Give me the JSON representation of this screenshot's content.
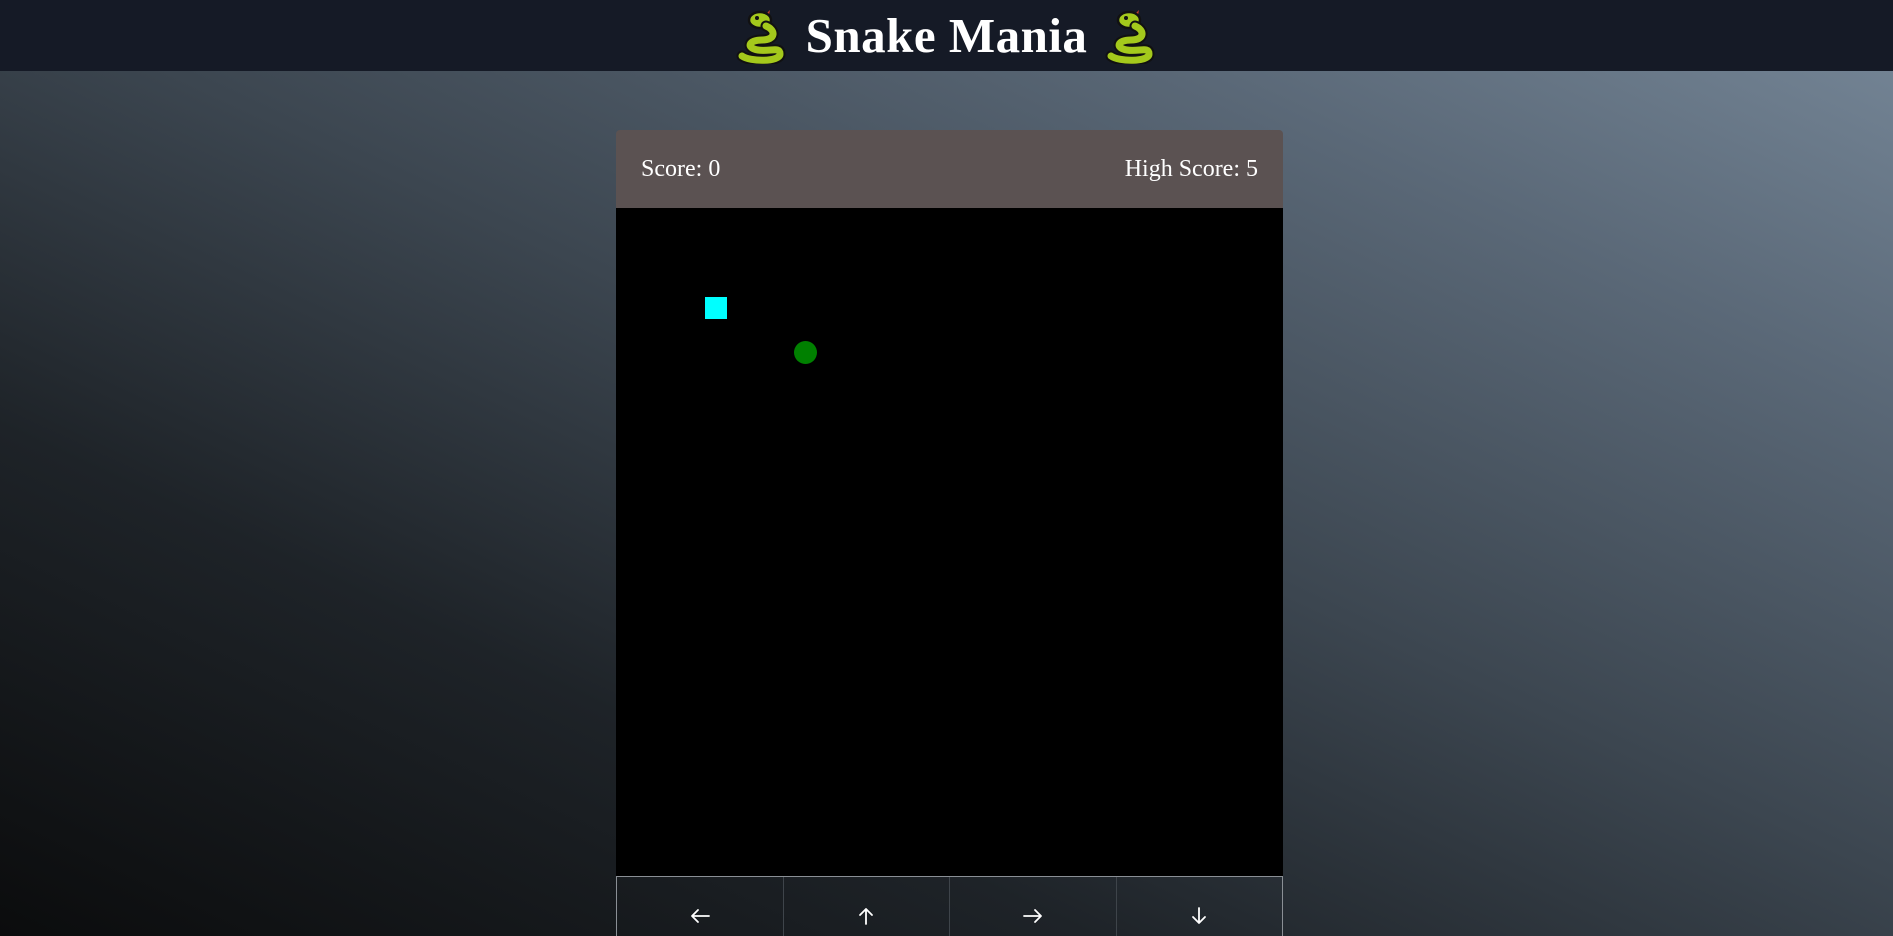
{
  "header": {
    "title": "Snake Mania",
    "left_icon": "snake-icon",
    "right_icon": "snake-icon"
  },
  "scoreboard": {
    "score_label": "Score: 0",
    "high_score_label": "High Score: 5"
  },
  "board": {
    "background": "#000000",
    "snake_color": "#00ffff",
    "food_color": "#008000"
  },
  "controls": [
    {
      "name": "left",
      "icon": "arrow-left-icon"
    },
    {
      "name": "up",
      "icon": "arrow-up-icon"
    },
    {
      "name": "right",
      "icon": "arrow-right-icon"
    },
    {
      "name": "down",
      "icon": "arrow-down-icon"
    }
  ],
  "colors": {
    "header_bg": "#151a26",
    "score_bar_bg": "#5b5252",
    "text": "#ffffff"
  }
}
